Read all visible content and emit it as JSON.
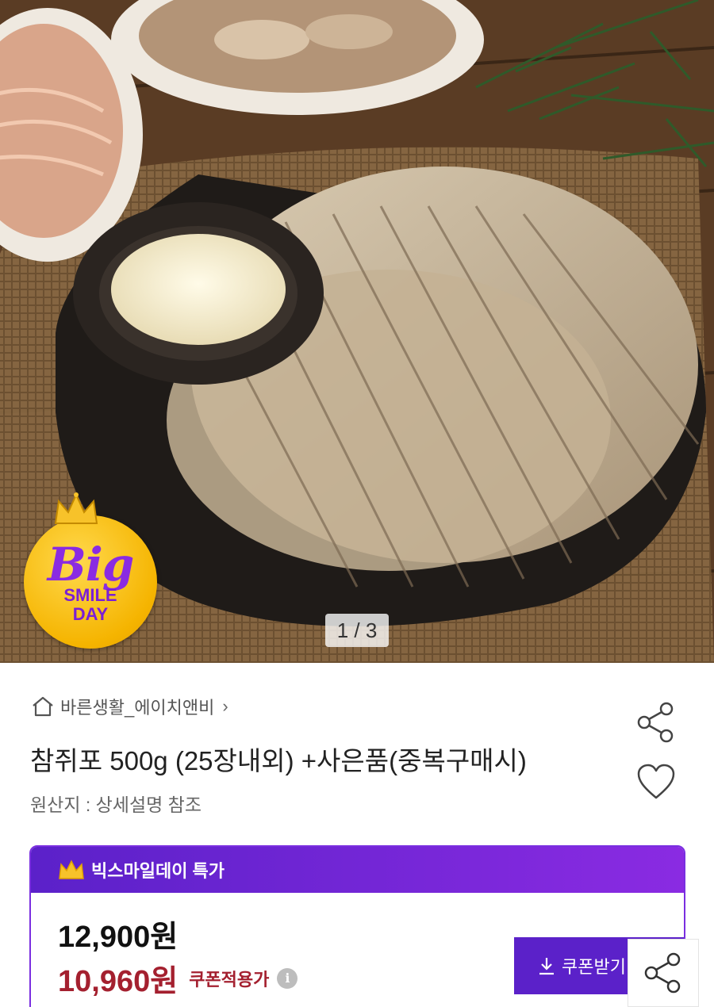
{
  "hero": {
    "page_indicator": "1 / 3",
    "badge": {
      "line1": "Big",
      "line2": "SMILE",
      "line3": "DAY"
    }
  },
  "store": {
    "name": "바른생활_에이치앤비",
    "chevron": "›"
  },
  "product": {
    "title": "참쥐포 500g (25장내외) +사은품(중복구매시)",
    "origin": "원산지 : 상세설명 참조"
  },
  "deal": {
    "header": "빅스마일데이 특가",
    "original_price": "12,900원",
    "sale_price": "10,960원",
    "sale_note": "쿠폰적용가",
    "info_glyph": "i",
    "coupon_button": "쿠폰받기"
  },
  "icons": {
    "home": "home-icon",
    "share": "share-icon",
    "heart": "heart-icon",
    "crown": "crown-icon",
    "download": "download-icon",
    "info": "info-icon"
  },
  "colors": {
    "accent_purple": "#5b21c9",
    "sale_red": "#a4202f",
    "badge_yellow": "#f5b400"
  }
}
